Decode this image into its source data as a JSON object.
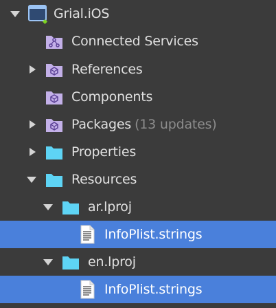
{
  "colors": {
    "background": "#3b3b3b",
    "selection": "#4a80db",
    "text": "#e0e0e0",
    "muted_text": "#8c8c8c",
    "folder_cyan": "#5ed4f5",
    "folder_purple": "#c3b0e8"
  },
  "tree": {
    "project": {
      "label": "Grial.iOS",
      "icon": "ios-project-icon",
      "expanded": true
    },
    "connected_services": {
      "label": "Connected Services",
      "icon": "connected-services-folder-icon"
    },
    "references": {
      "label": "References",
      "icon": "references-folder-icon",
      "expanded": false
    },
    "components": {
      "label": "Components",
      "icon": "components-folder-icon"
    },
    "packages": {
      "label": "Packages",
      "note": "(13 updates)",
      "icon": "packages-folder-icon",
      "expanded": false
    },
    "properties": {
      "label": "Properties",
      "icon": "folder-icon",
      "expanded": false
    },
    "resources": {
      "label": "Resources",
      "icon": "folder-icon",
      "expanded": true
    },
    "ar_lproj": {
      "label": "ar.lproj",
      "icon": "folder-icon",
      "expanded": true
    },
    "ar_infoplist": {
      "label": "InfoPlist.strings",
      "icon": "strings-file-icon",
      "selected": true
    },
    "en_lproj": {
      "label": "en.lproj",
      "icon": "folder-icon",
      "expanded": true
    },
    "en_infoplist": {
      "label": "InfoPlist.strings",
      "icon": "strings-file-icon",
      "selected": true
    }
  }
}
